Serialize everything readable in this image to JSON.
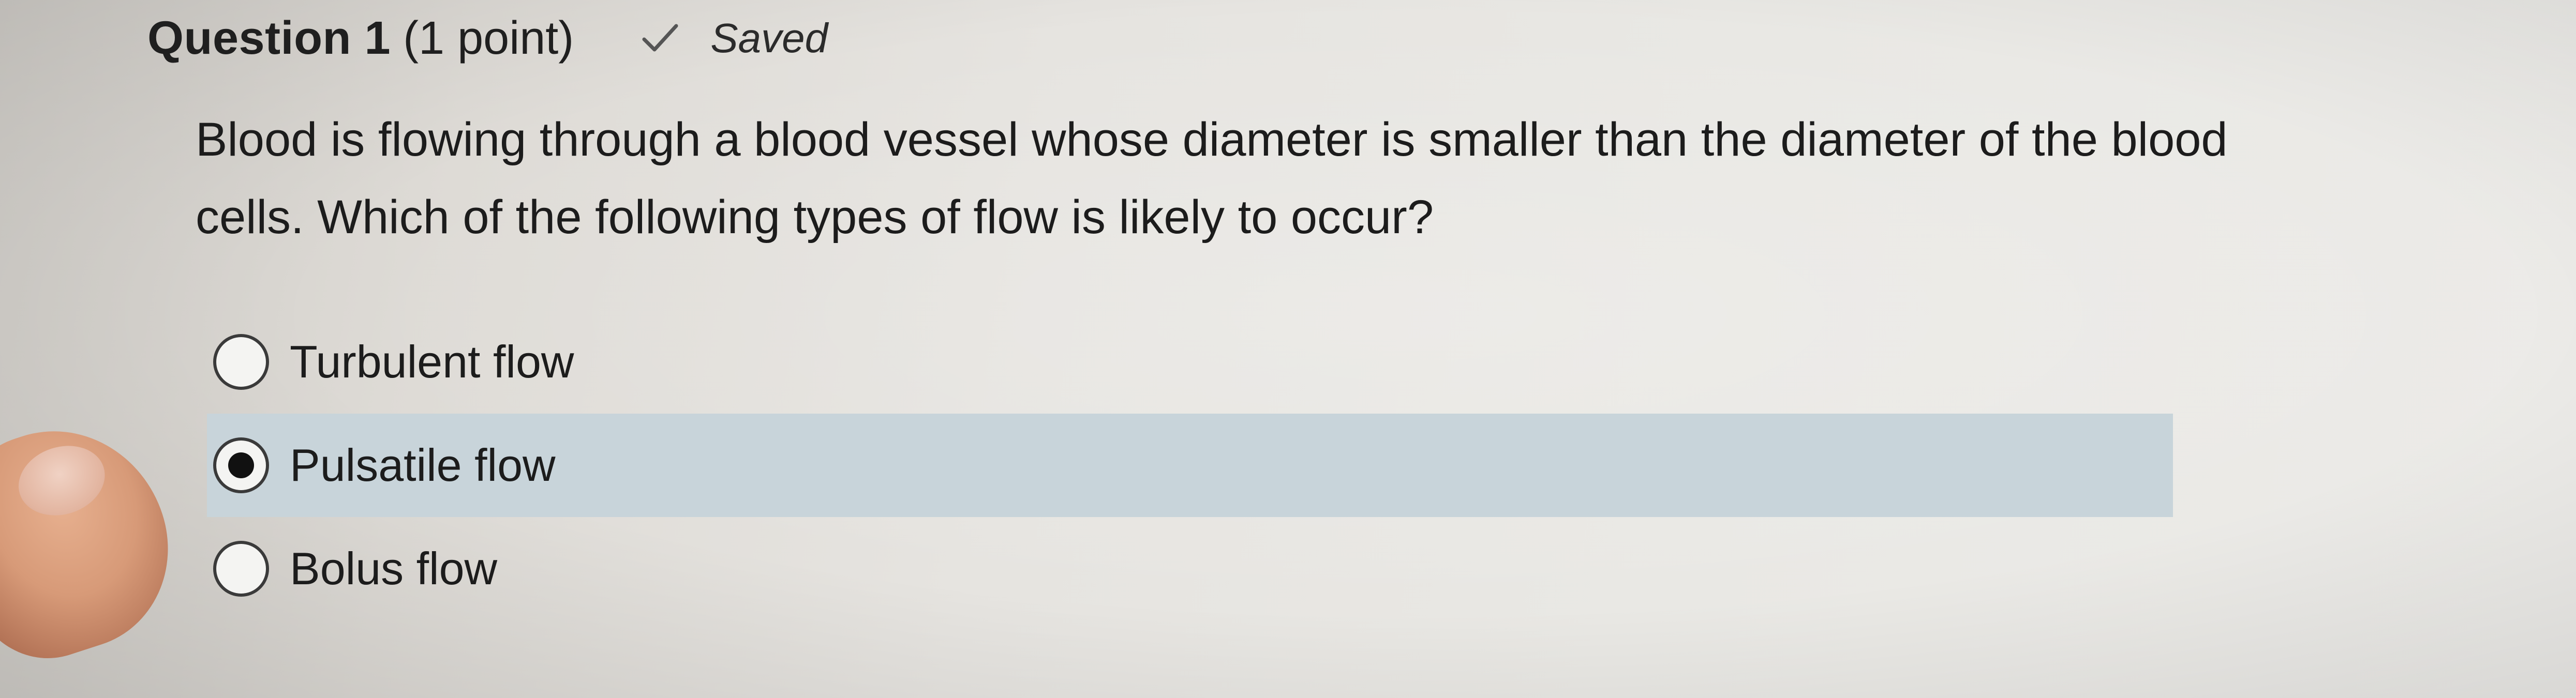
{
  "question": {
    "title": "Question 1",
    "points": "(1 point)",
    "status": "Saved",
    "status_icon": "check-icon",
    "text": "Blood is flowing through a blood vessel whose diameter is smaller than the diameter of the blood cells. Which of the following types of flow is likely to occur?"
  },
  "options": [
    {
      "label": "Turbulent flow",
      "selected": false
    },
    {
      "label": "Pulsatile flow",
      "selected": true
    },
    {
      "label": "Bolus flow",
      "selected": false
    }
  ],
  "colors": {
    "selected_highlight": "#c8d4da",
    "text": "#1c1c1c"
  }
}
